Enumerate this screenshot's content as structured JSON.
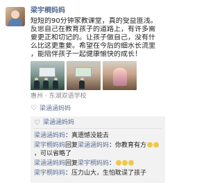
{
  "post": {
    "author": "梁宇桐妈妈",
    "text_lines": [
      "短短的90分钟家教课堂，真的受益匪浅。",
      "反思自己在教育孩子的道路上，有许多需",
      "要更正和切记的。让孩子做自己，没有什",
      "么比这更重要。希望在今后的细水长流里",
      "，能陪伴孩子一起健康愉快的成长！"
    ],
    "location": "惠州 · 东湖双语学校"
  },
  "likes": {
    "names": "梁涵涵妈妈"
  },
  "comments": {
    "header_name": "梁涵涵妈妈",
    "items": [
      {
        "author": "梁涵涵妈妈",
        "text": "：真遗憾没能去"
      },
      {
        "author": "梁宇桐妈妈",
        "reply_word": "回复",
        "target": "梁涵涵妈妈",
        "text": "：你教育有方",
        "emoji_count": 2,
        "text2": "，可以省略了"
      },
      {
        "author": "梁涵涵妈妈",
        "reply_word": "回复",
        "target": "梁宇桐妈妈",
        "text": "：",
        "emoji_count": 3
      },
      {
        "author": "梁宇桐妈妈",
        "text": "：压力山大，生怕耽误了孩子"
      }
    ]
  },
  "icons": {
    "like": "heart-icon",
    "comment": "heart-icon"
  },
  "colors": {
    "name_blue": "#5b6f95",
    "comment_bg": "#f2f2f2",
    "emoji": "#f2c84b"
  }
}
